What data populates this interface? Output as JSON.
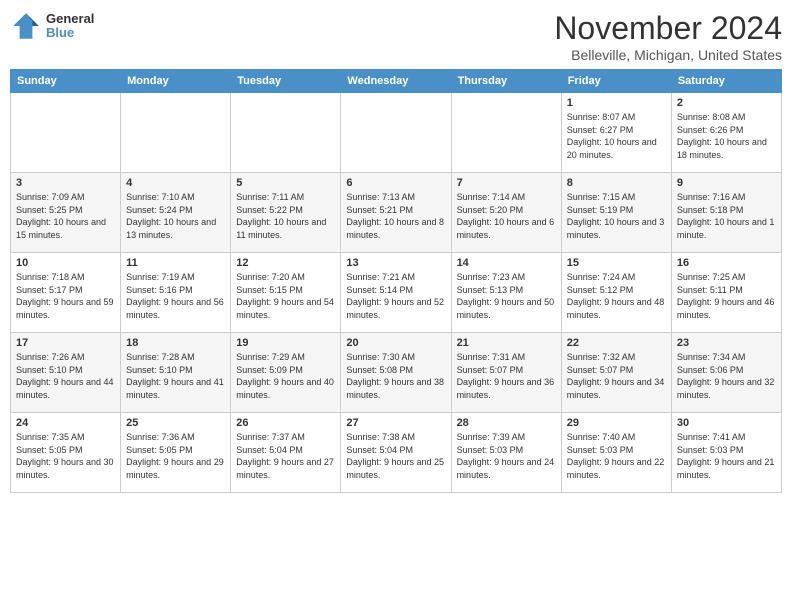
{
  "logo": {
    "general": "General",
    "blue": "Blue"
  },
  "header": {
    "month": "November 2024",
    "location": "Belleville, Michigan, United States"
  },
  "weekdays": [
    "Sunday",
    "Monday",
    "Tuesday",
    "Wednesday",
    "Thursday",
    "Friday",
    "Saturday"
  ],
  "weeks": [
    [
      {
        "day": "",
        "info": ""
      },
      {
        "day": "",
        "info": ""
      },
      {
        "day": "",
        "info": ""
      },
      {
        "day": "",
        "info": ""
      },
      {
        "day": "",
        "info": ""
      },
      {
        "day": "1",
        "info": "Sunrise: 8:07 AM\nSunset: 6:27 PM\nDaylight: 10 hours and 20 minutes."
      },
      {
        "day": "2",
        "info": "Sunrise: 8:08 AM\nSunset: 6:26 PM\nDaylight: 10 hours and 18 minutes."
      }
    ],
    [
      {
        "day": "3",
        "info": "Sunrise: 7:09 AM\nSunset: 5:25 PM\nDaylight: 10 hours and 15 minutes."
      },
      {
        "day": "4",
        "info": "Sunrise: 7:10 AM\nSunset: 5:24 PM\nDaylight: 10 hours and 13 minutes."
      },
      {
        "day": "5",
        "info": "Sunrise: 7:11 AM\nSunset: 5:22 PM\nDaylight: 10 hours and 11 minutes."
      },
      {
        "day": "6",
        "info": "Sunrise: 7:13 AM\nSunset: 5:21 PM\nDaylight: 10 hours and 8 minutes."
      },
      {
        "day": "7",
        "info": "Sunrise: 7:14 AM\nSunset: 5:20 PM\nDaylight: 10 hours and 6 minutes."
      },
      {
        "day": "8",
        "info": "Sunrise: 7:15 AM\nSunset: 5:19 PM\nDaylight: 10 hours and 3 minutes."
      },
      {
        "day": "9",
        "info": "Sunrise: 7:16 AM\nSunset: 5:18 PM\nDaylight: 10 hours and 1 minute."
      }
    ],
    [
      {
        "day": "10",
        "info": "Sunrise: 7:18 AM\nSunset: 5:17 PM\nDaylight: 9 hours and 59 minutes."
      },
      {
        "day": "11",
        "info": "Sunrise: 7:19 AM\nSunset: 5:16 PM\nDaylight: 9 hours and 56 minutes."
      },
      {
        "day": "12",
        "info": "Sunrise: 7:20 AM\nSunset: 5:15 PM\nDaylight: 9 hours and 54 minutes."
      },
      {
        "day": "13",
        "info": "Sunrise: 7:21 AM\nSunset: 5:14 PM\nDaylight: 9 hours and 52 minutes."
      },
      {
        "day": "14",
        "info": "Sunrise: 7:23 AM\nSunset: 5:13 PM\nDaylight: 9 hours and 50 minutes."
      },
      {
        "day": "15",
        "info": "Sunrise: 7:24 AM\nSunset: 5:12 PM\nDaylight: 9 hours and 48 minutes."
      },
      {
        "day": "16",
        "info": "Sunrise: 7:25 AM\nSunset: 5:11 PM\nDaylight: 9 hours and 46 minutes."
      }
    ],
    [
      {
        "day": "17",
        "info": "Sunrise: 7:26 AM\nSunset: 5:10 PM\nDaylight: 9 hours and 44 minutes."
      },
      {
        "day": "18",
        "info": "Sunrise: 7:28 AM\nSunset: 5:10 PM\nDaylight: 9 hours and 41 minutes."
      },
      {
        "day": "19",
        "info": "Sunrise: 7:29 AM\nSunset: 5:09 PM\nDaylight: 9 hours and 40 minutes."
      },
      {
        "day": "20",
        "info": "Sunrise: 7:30 AM\nSunset: 5:08 PM\nDaylight: 9 hours and 38 minutes."
      },
      {
        "day": "21",
        "info": "Sunrise: 7:31 AM\nSunset: 5:07 PM\nDaylight: 9 hours and 36 minutes."
      },
      {
        "day": "22",
        "info": "Sunrise: 7:32 AM\nSunset: 5:07 PM\nDaylight: 9 hours and 34 minutes."
      },
      {
        "day": "23",
        "info": "Sunrise: 7:34 AM\nSunset: 5:06 PM\nDaylight: 9 hours and 32 minutes."
      }
    ],
    [
      {
        "day": "24",
        "info": "Sunrise: 7:35 AM\nSunset: 5:05 PM\nDaylight: 9 hours and 30 minutes."
      },
      {
        "day": "25",
        "info": "Sunrise: 7:36 AM\nSunset: 5:05 PM\nDaylight: 9 hours and 29 minutes."
      },
      {
        "day": "26",
        "info": "Sunrise: 7:37 AM\nSunset: 5:04 PM\nDaylight: 9 hours and 27 minutes."
      },
      {
        "day": "27",
        "info": "Sunrise: 7:38 AM\nSunset: 5:04 PM\nDaylight: 9 hours and 25 minutes."
      },
      {
        "day": "28",
        "info": "Sunrise: 7:39 AM\nSunset: 5:03 PM\nDaylight: 9 hours and 24 minutes."
      },
      {
        "day": "29",
        "info": "Sunrise: 7:40 AM\nSunset: 5:03 PM\nDaylight: 9 hours and 22 minutes."
      },
      {
        "day": "30",
        "info": "Sunrise: 7:41 AM\nSunset: 5:03 PM\nDaylight: 9 hours and 21 minutes."
      }
    ]
  ]
}
